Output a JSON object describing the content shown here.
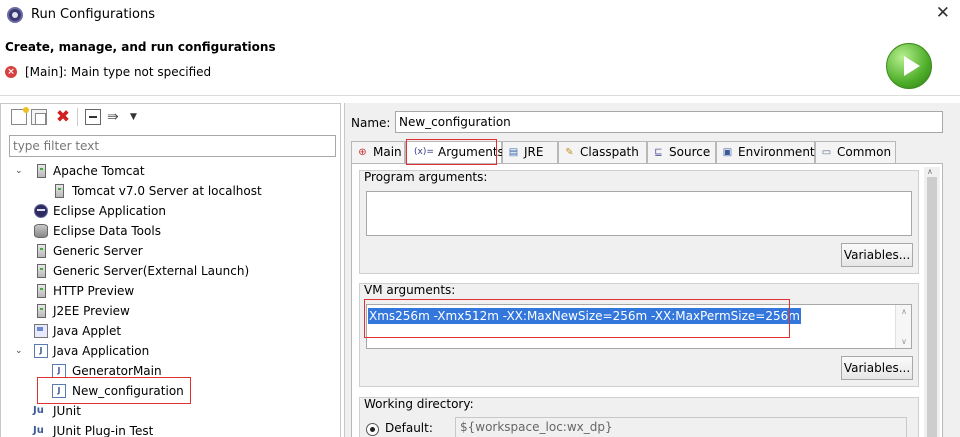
{
  "window": {
    "title": "Run Configurations",
    "close_glyph": "✕"
  },
  "header": {
    "title": "Create, manage, and run configurations",
    "error_message": "[Main]: Main type not specified",
    "run_icon": "run-icon"
  },
  "left_toolbar": {
    "icons": [
      "new-launch-configuration-icon",
      "duplicate-icon",
      "delete-icon",
      "collapse-all-icon",
      "filter-icon",
      "view-menu-icon"
    ],
    "delete_glyph": "✖",
    "filter_glyph": "⇛",
    "menu_glyph": "▼"
  },
  "filter": {
    "placeholder": "type filter text"
  },
  "tree": {
    "items": [
      {
        "label": "Apache Tomcat",
        "expanded": true,
        "icon": "server-icon"
      },
      {
        "label": "Tomcat v7.0 Server at localhost",
        "icon": "server-icon"
      },
      {
        "label": "Eclipse Application",
        "icon": "eclipse-icon"
      },
      {
        "label": "Eclipse Data Tools",
        "icon": "database-icon"
      },
      {
        "label": "Generic Server",
        "icon": "server-icon"
      },
      {
        "label": "Generic Server(External Launch)",
        "icon": "server-icon"
      },
      {
        "label": "HTTP Preview",
        "icon": "server-icon"
      },
      {
        "label": "J2EE Preview",
        "icon": "server-icon"
      },
      {
        "label": "Java Applet",
        "icon": "applet-icon"
      },
      {
        "label": "Java Application",
        "expanded": true,
        "icon": "java-app-icon"
      },
      {
        "label": "GeneratorMain",
        "icon": "java-app-icon"
      },
      {
        "label": "New_configuration",
        "icon": "java-app-icon",
        "selected": true
      },
      {
        "label": "JUnit",
        "icon": "junit-icon"
      },
      {
        "label": "JUnit Plug-in Test",
        "icon": "junit-icon"
      }
    ],
    "java_glyph": "J",
    "junit_glyph": "Ju",
    "expanded_glyph": "⌄"
  },
  "config": {
    "name_label": "Name:",
    "name_value": "New_configuration"
  },
  "tabs": [
    {
      "label": "Main",
      "icon": "main-tab-icon",
      "glyph": "⊕"
    },
    {
      "label": "Arguments",
      "icon": "arguments-tab-icon",
      "glyph": "(x)=",
      "active": true
    },
    {
      "label": "JRE",
      "icon": "jre-tab-icon",
      "glyph": "▤"
    },
    {
      "label": "Classpath",
      "icon": "classpath-tab-icon",
      "glyph": "✎"
    },
    {
      "label": "Source",
      "icon": "source-tab-icon",
      "glyph": "⊑"
    },
    {
      "label": "Environment",
      "icon": "environment-tab-icon",
      "glyph": "▣"
    },
    {
      "label": "Common",
      "icon": "common-tab-icon",
      "glyph": "▭"
    }
  ],
  "arguments": {
    "program_label": "Program arguments:",
    "program_value": "",
    "program_variables": "Variables...",
    "vm_label": "VM arguments:",
    "vm_value": "Xms256m -Xmx512m -XX:MaxNewSize=256m -XX:MaxPermSize=256m",
    "vm_variables": "Variables...",
    "working_dir_label": "Working directory:",
    "default_label": "Default:",
    "default_value": "${workspace_loc:wx_dp}"
  },
  "scroll_glyphs": {
    "up": "∧",
    "down": "∨"
  },
  "colors": {
    "highlight_box": "#e03030",
    "selection": "#3377dd",
    "run_button": "#4fae2a",
    "error": "#d84040"
  }
}
